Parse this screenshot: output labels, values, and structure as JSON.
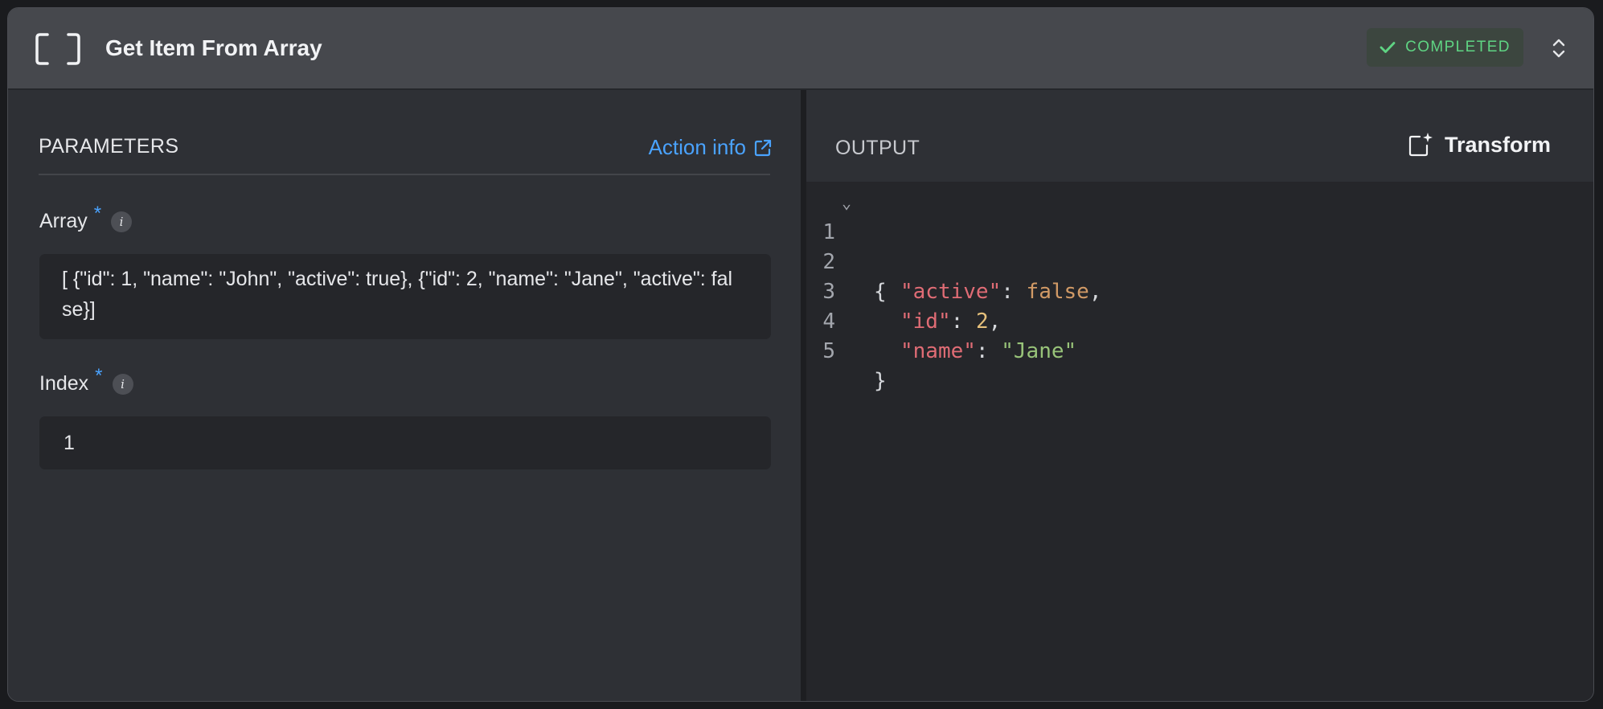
{
  "header": {
    "title": "Get Item From Array",
    "status": "COMPLETED"
  },
  "parameters": {
    "title": "PARAMETERS",
    "action_info": "Action info",
    "fields": [
      {
        "label": "Array",
        "required_mark": "*",
        "info_glyph": "i",
        "value": "[ {\"id\": 1, \"name\": \"John\", \"active\": true}, {\"id\": 2, \"name\": \"Jane\", \"active\": false}]"
      },
      {
        "label": "Index",
        "required_mark": "*",
        "info_glyph": "i",
        "value": "1"
      }
    ]
  },
  "output": {
    "title": "OUTPUT",
    "transform_label": "Transform",
    "line_numbers": [
      "1",
      "2",
      "3",
      "4",
      "5"
    ],
    "json": {
      "open_brace": "{",
      "close_brace": "}",
      "entries": [
        {
          "key": "\"active\"",
          "value": "false",
          "value_type": "boolean",
          "trailing": ","
        },
        {
          "key": "\"id\"",
          "value": "2",
          "value_type": "number",
          "trailing": ","
        },
        {
          "key": "\"name\"",
          "value": "\"Jane\"",
          "value_type": "string",
          "trailing": ""
        }
      ]
    }
  },
  "colors": {
    "accent_blue": "#4aa3ff",
    "success_green": "#5fd483",
    "json_key": "#e06c75",
    "json_boolean": "#d19a66",
    "json_number": "#e5c07b",
    "json_string": "#98c379"
  },
  "icons": {
    "header": "bracket-icon",
    "status": "check-icon",
    "expand": "chevron-up-down-icon",
    "action_info": "external-link-icon",
    "transform": "sparkle-square-icon",
    "fold": "chevron-down-icon"
  }
}
